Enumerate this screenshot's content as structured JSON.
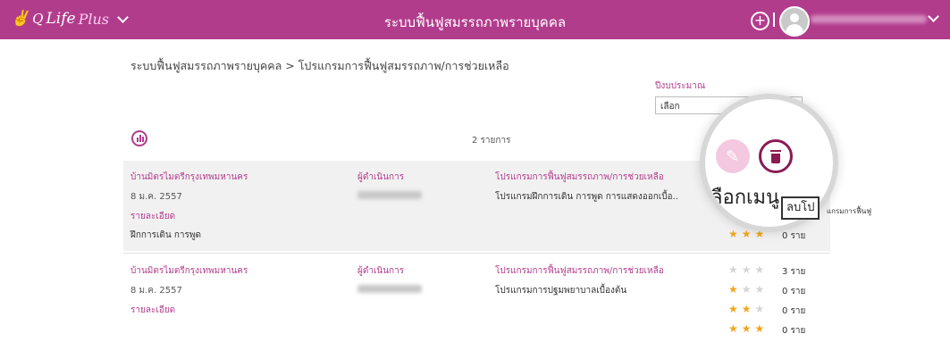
{
  "header": {
    "logo_q": "Q",
    "logo_life": "Life",
    "logo_plus": "Plus",
    "title": "ระบบฟื้นฟูสมรรถภาพรายบุคคล",
    "add_label": "+"
  },
  "breadcrumb": "ระบบฟื้นฟูสมรรถภาพรายบุคคล > โปรแกรมการฟื้นฟูสมรรถภาพ/การช่วยเหลือ",
  "budget": {
    "label": "ปีงบประมาณ",
    "selected": "เลือก"
  },
  "list_count": "2 รายการ",
  "records": [
    {
      "org": "บ้านมิตรไมตรีกรุงเทพมหานคร",
      "date": "8 ม.ค. 2557",
      "detail_link": "รายละเอียด",
      "activity": "ฝึกการเดิน การพูด",
      "operator_label": "ผู้ดำเนินการ",
      "program_label": "โปรแกรมการฟื้นฟูสมรรถภาพ/การช่วยเหลือ",
      "program": "โปรแกรมฝึกการเดิน การพูด การแสดงออกเบื้อ..",
      "ratings": [
        {
          "stars": 3,
          "count": "0 ราย"
        }
      ]
    },
    {
      "org": "บ้านมิตรไมตรีกรุงเทพมหานคร",
      "date": "8 ม.ค. 2557",
      "detail_link": "รายละเอียด",
      "operator_label": "ผู้ดำเนินการ",
      "program_label": "โปรแกรมการฟื้นฟูสมรรถภาพ/การช่วยเหลือ",
      "program": "โปรแกรมการปฐมพยาบาลเบื้องต้น",
      "ratings": [
        {
          "stars": 0,
          "count": "3 ราย"
        },
        {
          "stars": 1,
          "count": "0 ราย"
        },
        {
          "stars": 2,
          "count": "0 ราย"
        },
        {
          "stars": 3,
          "count": "0 ราย"
        }
      ]
    }
  ],
  "menu_popup": {
    "magnified_text": "ลือกเมนู",
    "delete_tooltip": "ลบโป",
    "tooltip_tail": "แกรมการฟื้นฟู"
  },
  "colors": {
    "primary": "#b23c8c",
    "star": "#f2a51c"
  },
  "icons": [
    "chevron-down-icon",
    "plus-circle-icon",
    "user-avatar-icon",
    "bar-chart-icon",
    "pencil-icon",
    "trash-icon",
    "star-icon"
  ]
}
